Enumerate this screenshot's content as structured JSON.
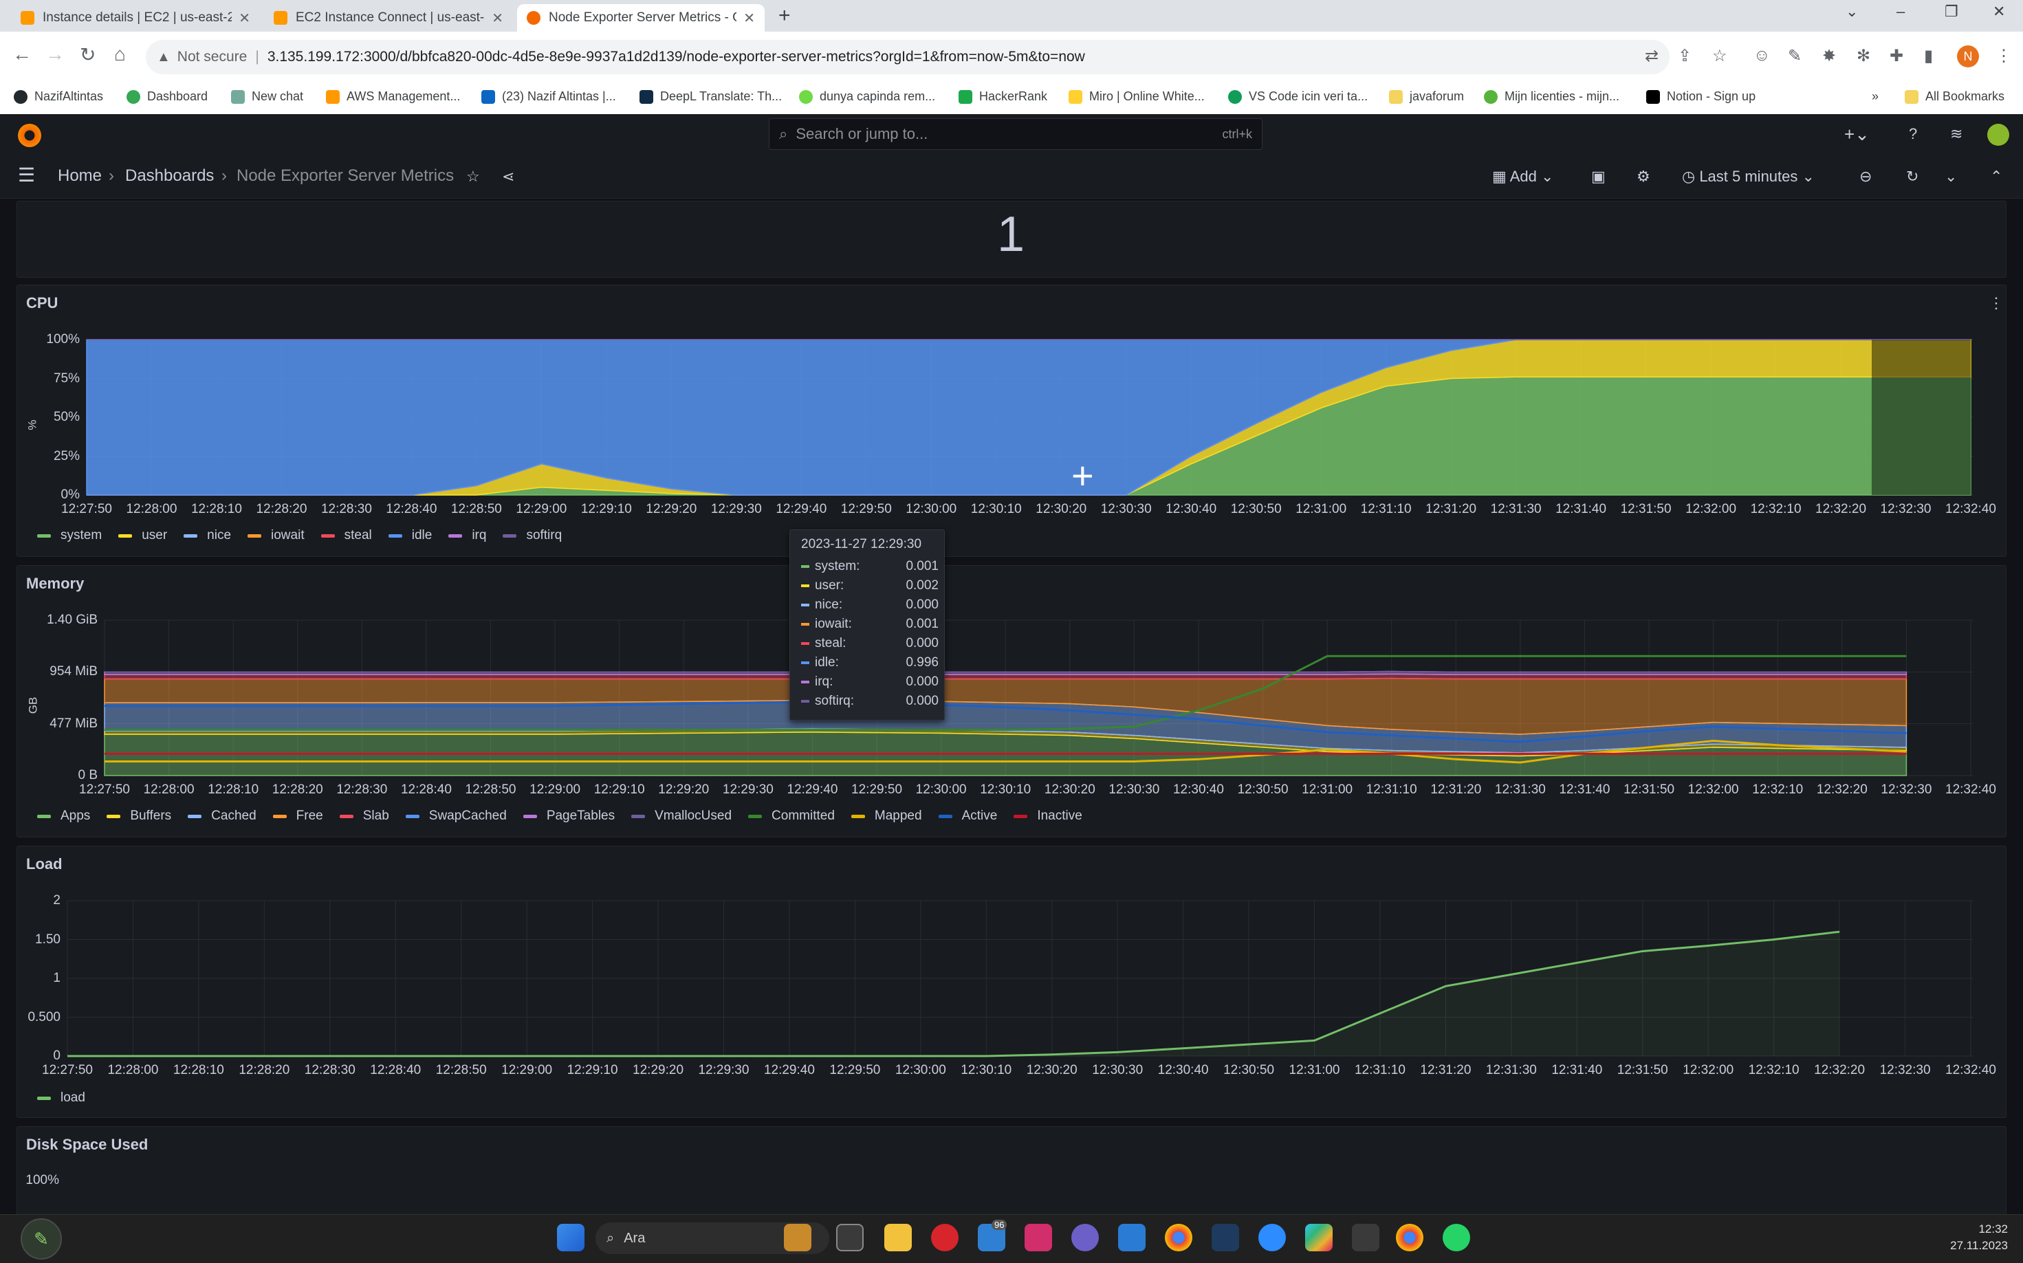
{
  "browser": {
    "tabs": [
      {
        "title": "Instance details | EC2 | us-east-2",
        "color": "#ff9900"
      },
      {
        "title": "EC2 Instance Connect | us-east-",
        "color": "#ff9900"
      },
      {
        "title": "Node Exporter Server Metrics - G",
        "color": "#f46800"
      }
    ],
    "not_secure": "Not secure",
    "url": "3.135.199.172:3000/d/bbfca820-00dc-4d5e-8e9e-9937a1d2d139/node-exporter-server-metrics?orgId=1&from=now-5m&to=now",
    "bookmarks": [
      {
        "label": "NazifAltintas",
        "color": "#24292e"
      },
      {
        "label": "Dashboard",
        "color": "#34a853"
      },
      {
        "label": "New chat",
        "color": "#74aa9c"
      },
      {
        "label": "AWS Management...",
        "color": "#ff9900"
      },
      {
        "label": "(23) Nazif Altintas |...",
        "color": "#0a66c2"
      },
      {
        "label": "DeepL Translate: Th...",
        "color": "#0f2b46"
      },
      {
        "label": "dunya capinda rem...",
        "color": "#6fda44"
      },
      {
        "label": "HackerRank",
        "color": "#1ba94c"
      },
      {
        "label": "Miro | Online White...",
        "color": "#ffd02f"
      },
      {
        "label": "VS Code icin veri ta...",
        "color": "#0f9d58"
      },
      {
        "label": "javaforum",
        "color": "#f4d35e"
      },
      {
        "label": "Mijn licenties - mijn...",
        "color": "#56b43a"
      },
      {
        "label": "Notion - Sign up",
        "color": "#000000"
      }
    ],
    "all_bookmarks": "All Bookmarks",
    "profile_initial": "N"
  },
  "grafana": {
    "search_placeholder": "Search or jump to...",
    "search_shortcut": "ctrl+k",
    "breadcrumb": [
      "Home",
      "Dashboards",
      "Node Exporter Server Metrics"
    ],
    "add_label": "Add",
    "time_range": "Last 5 minutes",
    "stat_value": "1"
  },
  "panels": {
    "cpu": {
      "title": "CPU",
      "y_unit_label": "%"
    },
    "memory": {
      "title": "Memory",
      "y_unit_label": "GB"
    },
    "load": {
      "title": "Load"
    },
    "disk": {
      "title": "Disk Space Used",
      "y_ticks": [
        "100%"
      ]
    }
  },
  "tooltip": {
    "time": "2023-11-27 12:29:30",
    "rows": [
      {
        "label": "system:",
        "value": "0.001",
        "color": "#73bf69"
      },
      {
        "label": "user:",
        "value": "0.002",
        "color": "#fade2a"
      },
      {
        "label": "nice:",
        "value": "0.000",
        "color": "#8ab8ff"
      },
      {
        "label": "iowait:",
        "value": "0.001",
        "color": "#ff9830"
      },
      {
        "label": "steal:",
        "value": "0.000",
        "color": "#f2495c"
      },
      {
        "label": "idle:",
        "value": "0.996",
        "color": "#5794f2"
      },
      {
        "label": "irq:",
        "value": "0.000",
        "color": "#b877d9"
      },
      {
        "label": "softirq:",
        "value": "0.000",
        "color": "#705da0"
      }
    ]
  },
  "taskbar": {
    "search_label": "Ara",
    "time": "12:32",
    "date": "27.11.2023",
    "mail_badge": "96"
  },
  "chart_data": [
    {
      "type": "area",
      "title": "CPU",
      "ylabel": "%",
      "x": [
        "12:27:50",
        "12:28:00",
        "12:28:10",
        "12:28:20",
        "12:28:30",
        "12:28:40",
        "12:28:50",
        "12:29:00",
        "12:29:10",
        "12:29:20",
        "12:29:30",
        "12:29:40",
        "12:29:50",
        "12:30:00",
        "12:30:10",
        "12:30:20",
        "12:30:30",
        "12:30:40",
        "12:30:50",
        "12:31:00",
        "12:31:10",
        "12:31:20",
        "12:31:30",
        "12:31:40",
        "12:31:50",
        "12:32:00",
        "12:32:10",
        "12:32:20",
        "12:32:30",
        "12:32:40"
      ],
      "y_ticks": [
        "0%",
        "25%",
        "50%",
        "75%",
        "100%"
      ],
      "ylim": [
        0,
        100
      ],
      "series": [
        {
          "name": "system",
          "color": "#73bf69",
          "values": [
            0,
            0,
            0,
            0,
            0,
            0,
            0,
            5,
            3,
            1,
            0,
            0,
            0,
            0,
            0,
            0,
            0,
            20,
            38,
            56,
            70,
            75,
            76,
            76,
            76,
            76,
            76,
            76,
            76,
            76
          ]
        },
        {
          "name": "user",
          "color": "#fade2a",
          "values": [
            0,
            0,
            0,
            0,
            0,
            0,
            6,
            15,
            8,
            3,
            0,
            0,
            0,
            0,
            0,
            0,
            0,
            5,
            8,
            10,
            12,
            18,
            24,
            24,
            24,
            24,
            24,
            24,
            24,
            24
          ]
        },
        {
          "name": "nice",
          "color": "#8ab8ff",
          "values": [
            0,
            0,
            0,
            0,
            0,
            0,
            0,
            0,
            0,
            0,
            0,
            0,
            0,
            0,
            0,
            0,
            0,
            0,
            0,
            0,
            0,
            0,
            0,
            0,
            0,
            0,
            0,
            0,
            0,
            0
          ]
        },
        {
          "name": "iowait",
          "color": "#ff9830",
          "values": [
            0,
            0,
            0,
            0,
            0,
            0,
            0,
            0,
            0,
            0,
            0,
            0,
            0,
            0,
            0,
            0,
            0,
            0,
            0,
            0,
            0,
            0,
            0,
            0,
            0,
            0,
            0,
            0,
            0,
            0
          ]
        },
        {
          "name": "steal",
          "color": "#f2495c",
          "values": [
            0,
            0,
            0,
            0,
            0,
            0,
            0,
            0,
            0,
            0,
            0,
            0,
            0,
            0,
            0,
            0,
            0,
            0,
            0,
            0,
            0,
            0,
            0,
            0,
            0,
            0,
            0,
            0,
            0,
            0
          ]
        },
        {
          "name": "idle",
          "color": "#5794f2",
          "values": [
            100,
            100,
            100,
            100,
            100,
            100,
            94,
            80,
            89,
            96,
            100,
            100,
            100,
            100,
            100,
            100,
            100,
            75,
            54,
            34,
            18,
            7,
            0,
            0,
            0,
            0,
            0,
            0,
            0,
            0
          ]
        },
        {
          "name": "irq",
          "color": "#b877d9",
          "values": [
            0,
            0,
            0,
            0,
            0,
            0,
            0,
            0,
            0,
            0,
            0,
            0,
            0,
            0,
            0,
            0,
            0,
            0,
            0,
            0,
            0,
            0,
            0,
            0,
            0,
            0,
            0,
            0,
            0,
            0
          ]
        },
        {
          "name": "softirq",
          "color": "#705da0",
          "values": [
            0,
            0,
            0,
            0,
            0,
            0,
            0,
            0,
            0,
            0,
            0,
            0,
            0,
            0,
            0,
            0,
            0,
            0,
            0,
            0,
            0,
            0,
            0,
            0,
            0,
            0,
            0,
            0,
            0,
            0
          ]
        }
      ],
      "legend": "bottom-left"
    },
    {
      "type": "area",
      "title": "Memory",
      "ylabel": "GB",
      "x": [
        "12:27:50",
        "12:28:00",
        "12:28:10",
        "12:28:20",
        "12:28:30",
        "12:28:40",
        "12:28:50",
        "12:29:00",
        "12:29:10",
        "12:29:20",
        "12:29:30",
        "12:29:40",
        "12:29:50",
        "12:30:00",
        "12:30:10",
        "12:30:20",
        "12:30:30",
        "12:30:40",
        "12:30:50",
        "12:31:00",
        "12:31:10",
        "12:31:20",
        "12:31:30",
        "12:31:40",
        "12:31:50",
        "12:32:00",
        "12:32:10",
        "12:32:20",
        "12:32:30",
        "12:32:40"
      ],
      "y_ticks": [
        "0 B",
        "477 MiB",
        "954 MiB",
        "1.40 GiB"
      ],
      "ylim_mib": [
        0,
        1431
      ],
      "series": [
        {
          "name": "Apps",
          "color": "#73bf69",
          "values_mib": [
            380,
            380,
            380,
            380,
            380,
            380,
            380,
            380,
            385,
            390,
            395,
            400,
            395,
            390,
            380,
            370,
            340,
            300,
            260,
            220,
            200,
            190,
            180,
            200,
            230,
            260,
            250,
            240,
            230,
            230
          ]
        },
        {
          "name": "Buffers",
          "color": "#fade2a",
          "values_mib": [
            30,
            30,
            30,
            30,
            30,
            30,
            30,
            30,
            30,
            30,
            30,
            30,
            30,
            30,
            30,
            30,
            30,
            30,
            30,
            30,
            30,
            30,
            30,
            30,
            30,
            30,
            30,
            30,
            30,
            30
          ]
        },
        {
          "name": "Cached",
          "color": "#8ab8ff",
          "values_mib": [
            260,
            260,
            260,
            260,
            260,
            262,
            262,
            262,
            262,
            262,
            262,
            262,
            262,
            262,
            262,
            262,
            262,
            250,
            230,
            210,
            195,
            180,
            170,
            180,
            190,
            200,
            200,
            200,
            200,
            200
          ]
        },
        {
          "name": "Free",
          "color": "#ff9830",
          "values_mib": [
            220,
            220,
            220,
            220,
            220,
            218,
            218,
            218,
            213,
            208,
            203,
            198,
            203,
            208,
            218,
            228,
            258,
            310,
            370,
            430,
            470,
            490,
            510,
            480,
            440,
            400,
            410,
            420,
            430,
            430
          ]
        },
        {
          "name": "Slab",
          "color": "#f2495c",
          "values_mib": [
            40,
            40,
            40,
            40,
            40,
            40,
            40,
            40,
            40,
            40,
            40,
            40,
            40,
            40,
            40,
            40,
            40,
            40,
            40,
            40,
            40,
            40,
            40,
            40,
            40,
            40,
            40,
            40,
            40,
            40
          ]
        },
        {
          "name": "SwapCached",
          "color": "#5794f2",
          "values_mib": [
            0,
            0,
            0,
            0,
            0,
            0,
            0,
            0,
            0,
            0,
            0,
            0,
            0,
            0,
            0,
            0,
            0,
            0,
            0,
            0,
            0,
            0,
            0,
            0,
            0,
            0,
            0,
            0,
            0,
            0
          ]
        },
        {
          "name": "PageTables",
          "color": "#b877d9",
          "values_mib": [
            24,
            24,
            24,
            24,
            24,
            24,
            24,
            24,
            24,
            24,
            24,
            24,
            24,
            24,
            24,
            24,
            24,
            24,
            24,
            24,
            24,
            24,
            24,
            24,
            24,
            24,
            24,
            24,
            24,
            24
          ]
        },
        {
          "name": "VmallocUsed",
          "color": "#705da0",
          "values_mib": [
            0,
            0,
            0,
            0,
            0,
            0,
            0,
            0,
            0,
            0,
            0,
            0,
            0,
            0,
            0,
            0,
            0,
            0,
            0,
            0,
            0,
            0,
            0,
            0,
            0,
            0,
            0,
            0,
            0,
            0
          ]
        }
      ],
      "line_series": [
        {
          "name": "Committed",
          "color": "#37872d",
          "values_mib": [
            420,
            420,
            420,
            420,
            420,
            420,
            420,
            420,
            420,
            420,
            420,
            420,
            420,
            420,
            420,
            430,
            450,
            600,
            800,
            1100,
            1100,
            1100,
            1100,
            1100,
            1100,
            1100,
            1100,
            1100,
            1100,
            1100
          ]
        },
        {
          "name": "Mapped",
          "color": "#e0b400",
          "values_mib": [
            130,
            130,
            130,
            130,
            130,
            130,
            130,
            130,
            130,
            130,
            130,
            130,
            130,
            130,
            130,
            130,
            130,
            150,
            190,
            240,
            200,
            150,
            120,
            200,
            260,
            320,
            280,
            250,
            220,
            220
          ]
        },
        {
          "name": "Active",
          "color": "#1f60c4",
          "values_mib": [
            640,
            640,
            640,
            640,
            640,
            640,
            640,
            640,
            650,
            660,
            670,
            680,
            670,
            650,
            630,
            600,
            560,
            520,
            460,
            400,
            370,
            340,
            310,
            360,
            410,
            450,
            430,
            410,
            390,
            390
          ]
        },
        {
          "name": "Inactive",
          "color": "#c4162a",
          "values_mib": [
            200,
            200,
            200,
            200,
            200,
            200,
            200,
            200,
            200,
            200,
            200,
            200,
            200,
            200,
            200,
            200,
            200,
            200,
            200,
            200,
            200,
            200,
            200,
            200,
            200,
            200,
            200,
            200,
            200,
            200
          ]
        }
      ],
      "legend": "bottom-left"
    },
    {
      "type": "line",
      "title": "Load",
      "x": [
        "12:27:50",
        "12:28:00",
        "12:28:10",
        "12:28:20",
        "12:28:30",
        "12:28:40",
        "12:28:50",
        "12:29:00",
        "12:29:10",
        "12:29:20",
        "12:29:30",
        "12:29:40",
        "12:29:50",
        "12:30:00",
        "12:30:10",
        "12:30:20",
        "12:30:30",
        "12:30:40",
        "12:30:50",
        "12:31:00",
        "12:31:10",
        "12:31:20",
        "12:31:30",
        "12:31:40",
        "12:31:50",
        "12:32:00",
        "12:32:10",
        "12:32:20",
        "12:32:30",
        "12:32:40"
      ],
      "y_ticks": [
        "0",
        "0.500",
        "1",
        "1.50",
        "2"
      ],
      "ylim": [
        0,
        2
      ],
      "series": [
        {
          "name": "load",
          "color": "#73bf69",
          "values": [
            0,
            0,
            0,
            0,
            0,
            0,
            0,
            0,
            0,
            0,
            0,
            0,
            0,
            0,
            0,
            0.02,
            0.05,
            0.1,
            0.15,
            0.2,
            0.55,
            0.9,
            1.05,
            1.2,
            1.35,
            1.42,
            1.5,
            1.6,
            null,
            null
          ]
        }
      ],
      "legend": "bottom-left"
    }
  ]
}
